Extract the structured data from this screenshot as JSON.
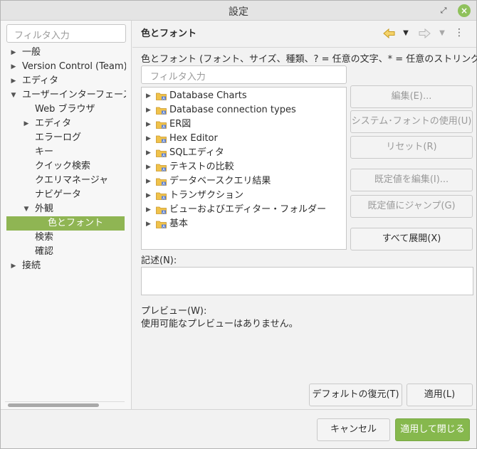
{
  "window": {
    "title": "設定"
  },
  "left": {
    "filter_placeholder": "フィルタ入力",
    "items": [
      {
        "label": "一般",
        "arrow": "▶"
      },
      {
        "label": "Version Control (Team)",
        "arrow": "▶"
      },
      {
        "label": "エディタ",
        "arrow": "▶"
      },
      {
        "label": "ユーザーインターフェース",
        "arrow": "▼"
      },
      {
        "label": "Web ブラウザ",
        "arrow": ""
      },
      {
        "label": "エディタ",
        "arrow": "▶"
      },
      {
        "label": "エラーログ",
        "arrow": ""
      },
      {
        "label": "キー",
        "arrow": ""
      },
      {
        "label": "クイック検索",
        "arrow": ""
      },
      {
        "label": "クエリマネージャ",
        "arrow": ""
      },
      {
        "label": "ナビゲータ",
        "arrow": ""
      },
      {
        "label": "外観",
        "arrow": "▼"
      },
      {
        "label": "色とフォント",
        "arrow": ""
      },
      {
        "label": "検索",
        "arrow": ""
      },
      {
        "label": "確認",
        "arrow": ""
      },
      {
        "label": "接続",
        "arrow": "▶"
      }
    ]
  },
  "right": {
    "title": "色とフォント",
    "section_label": "色とフォント (フォント、サイズ、種類、? = 任意の文字、* = 任意のストリング)(F):",
    "filter_placeholder": "フィルタ入力",
    "tree": [
      "Database Charts",
      "Database connection types",
      "ER図",
      "Hex Editor",
      "SQLエディタ",
      "テキストの比較",
      "データベースクエリ結果",
      "トランザクション",
      "ビューおよびエディター・フォルダー",
      "基本"
    ],
    "buttons": {
      "edit": "編集(E)...",
      "use_system_font": "システム･フォントの使用(U)",
      "reset": "リセット(R)",
      "edit_default": "既定値を編集(I)...",
      "jump_default": "既定値にジャンプ(G)",
      "expand_all": "すべて展開(X)"
    },
    "desc_label": "記述(N):",
    "preview_label": "プレビュー(W):",
    "preview_text": "使用可能なプレビューはありません。",
    "restore_defaults": "デフォルトの復元(T)",
    "apply": "適用(L)"
  },
  "footer": {
    "cancel": "キャンセル",
    "apply_close": "適用して閉じる"
  },
  "colors": {
    "accent": "#86b84d",
    "selection": "#8fb553"
  }
}
